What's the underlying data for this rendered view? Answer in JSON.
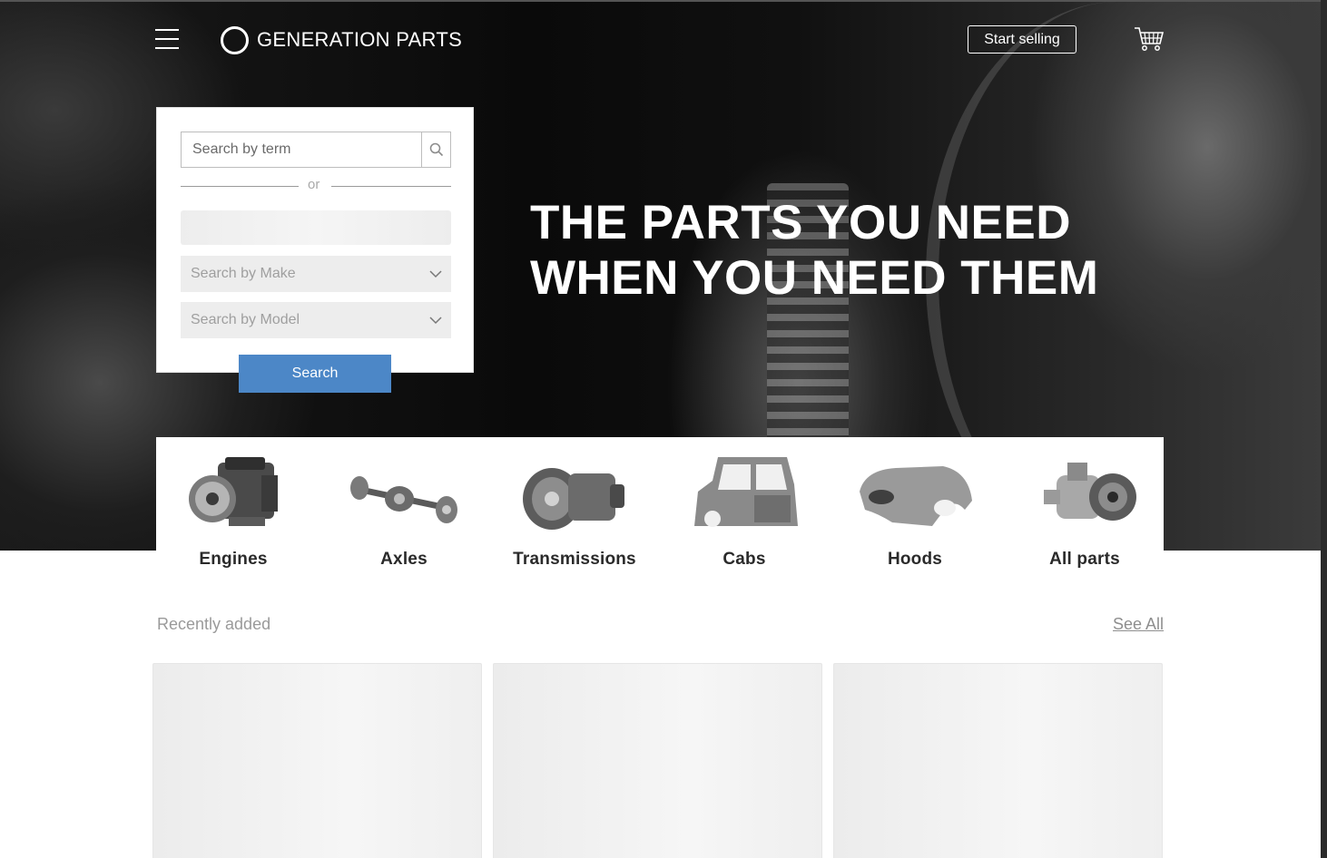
{
  "header": {
    "brand": "GENERATION PARTS",
    "start_selling": "Start selling"
  },
  "search": {
    "term_placeholder": "Search by term",
    "or": "or",
    "make_placeholder": "Search by Make",
    "model_placeholder": "Search by Model",
    "submit": "Search"
  },
  "hero": {
    "line1": "THE PARTS YOU NEED",
    "line2": "WHEN YOU NEED THEM"
  },
  "categories": [
    {
      "label": "Engines",
      "icon": "engine-icon"
    },
    {
      "label": "Axles",
      "icon": "axle-icon"
    },
    {
      "label": "Transmissions",
      "icon": "transmission-icon"
    },
    {
      "label": "Cabs",
      "icon": "cab-icon"
    },
    {
      "label": "Hoods",
      "icon": "hood-icon"
    },
    {
      "label": "All parts",
      "icon": "differential-icon"
    }
  ],
  "recent": {
    "title": "Recently added",
    "see_all": "See All"
  },
  "colors": {
    "accent": "#4c87c7",
    "hero_bg": "#111111",
    "skeleton": "#ededed"
  }
}
